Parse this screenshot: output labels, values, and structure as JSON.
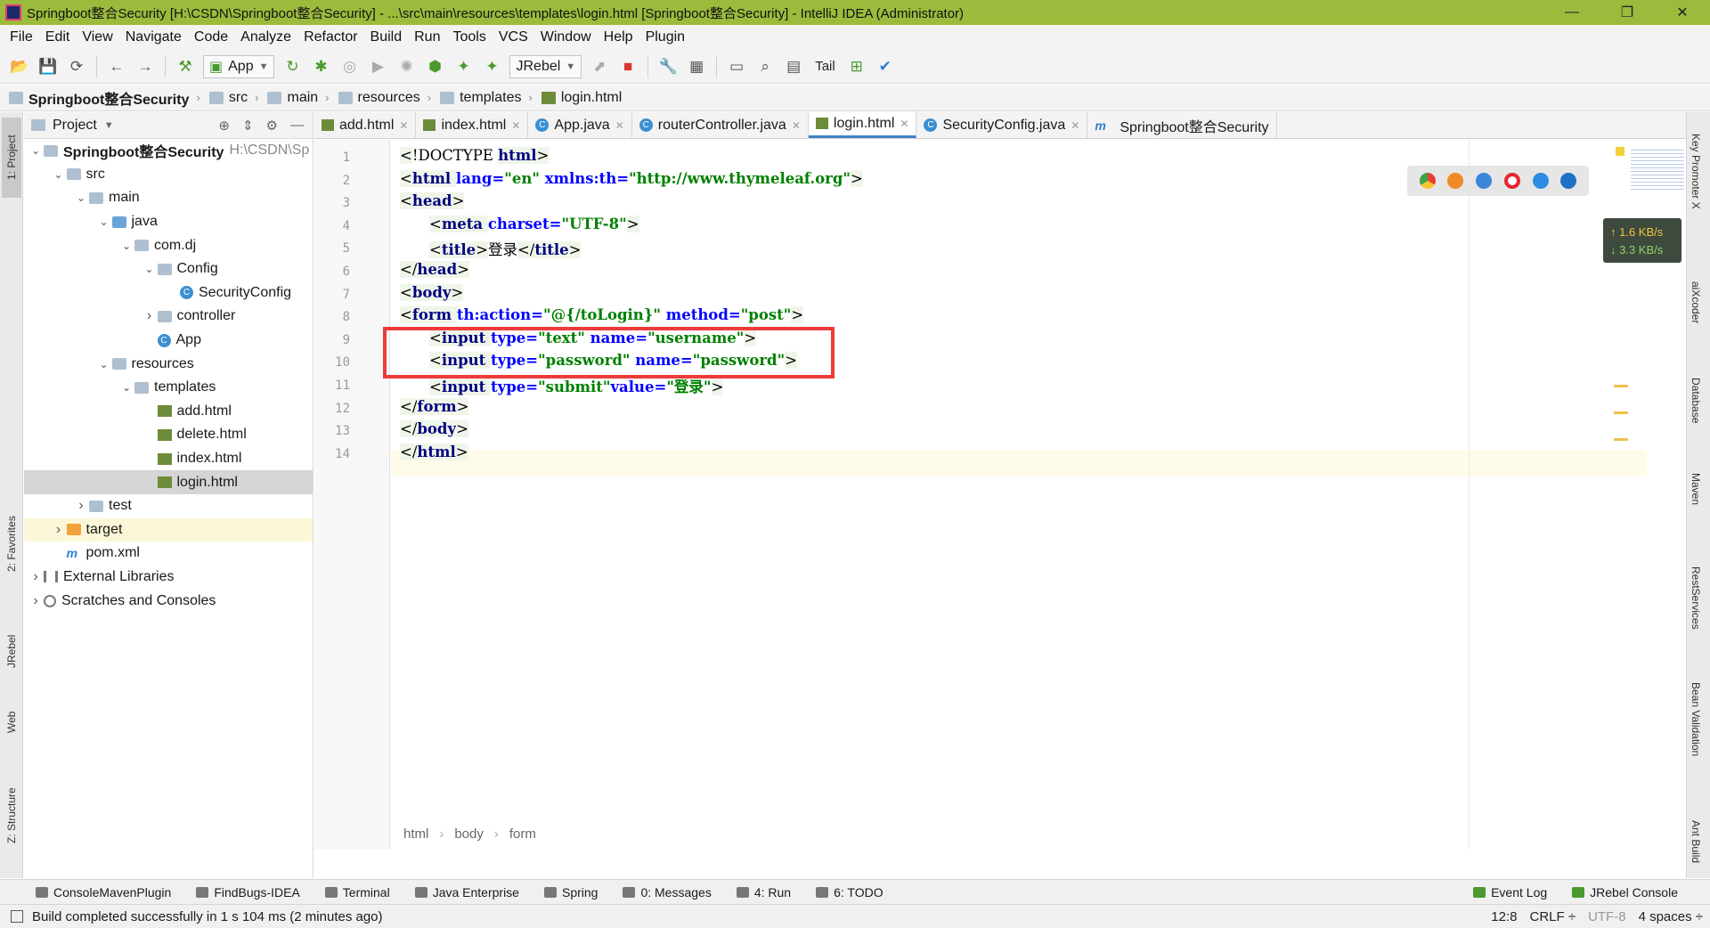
{
  "window": {
    "title": "Springboot整合Security [H:\\CSDN\\Springboot整合Security] - ...\\src\\main\\resources\\templates\\login.html [Springboot整合Security] - IntelliJ IDEA (Administrator)",
    "minimize": "—",
    "maximize": "❐",
    "close": "✕"
  },
  "menu": [
    "File",
    "Edit",
    "View",
    "Navigate",
    "Code",
    "Analyze",
    "Refactor",
    "Build",
    "Run",
    "Tools",
    "VCS",
    "Window",
    "Help",
    "Plugin"
  ],
  "toolbar": {
    "run_config": "App",
    "jrebel": "JRebel",
    "tail": "Tail"
  },
  "breadcrumb": [
    "Springboot整合Security",
    "src",
    "main",
    "resources",
    "templates",
    "login.html"
  ],
  "project": {
    "header": "Project",
    "tree": [
      {
        "label": "Springboot整合Security",
        "extra": "H:\\CSDN\\Sp",
        "depth": 0,
        "toggle": "open",
        "icon": "folder",
        "bold": true
      },
      {
        "label": "src",
        "depth": 1,
        "toggle": "open",
        "icon": "folder"
      },
      {
        "label": "main",
        "depth": 2,
        "toggle": "open",
        "icon": "folder"
      },
      {
        "label": "java",
        "depth": 3,
        "toggle": "open",
        "icon": "folder-blue"
      },
      {
        "label": "com.dj",
        "depth": 4,
        "toggle": "open",
        "icon": "folder"
      },
      {
        "label": "Config",
        "depth": 5,
        "toggle": "open",
        "icon": "folder"
      },
      {
        "label": "SecurityConfig",
        "depth": 6,
        "toggle": "",
        "icon": "class"
      },
      {
        "label": "controller",
        "depth": 5,
        "toggle": "closed",
        "icon": "folder"
      },
      {
        "label": "App",
        "depth": 5,
        "toggle": "",
        "icon": "class"
      },
      {
        "label": "resources",
        "depth": 3,
        "toggle": "open",
        "icon": "folder"
      },
      {
        "label": "templates",
        "depth": 4,
        "toggle": "open",
        "icon": "folder"
      },
      {
        "label": "add.html",
        "depth": 5,
        "toggle": "",
        "icon": "html"
      },
      {
        "label": "delete.html",
        "depth": 5,
        "toggle": "",
        "icon": "html"
      },
      {
        "label": "index.html",
        "depth": 5,
        "toggle": "",
        "icon": "html"
      },
      {
        "label": "login.html",
        "depth": 5,
        "toggle": "",
        "icon": "html",
        "selected": true
      },
      {
        "label": "test",
        "depth": 2,
        "toggle": "closed",
        "icon": "folder"
      },
      {
        "label": "target",
        "depth": 1,
        "toggle": "closed",
        "icon": "folder-orange",
        "highlight": true
      },
      {
        "label": "pom.xml",
        "depth": 1,
        "toggle": "",
        "icon": "maven"
      },
      {
        "label": "External Libraries",
        "depth": 0,
        "toggle": "closed",
        "icon": "lib"
      },
      {
        "label": "Scratches and Consoles",
        "depth": 0,
        "toggle": "closed",
        "icon": "scratch"
      }
    ]
  },
  "tabs": [
    {
      "label": "add.html",
      "icon": "html"
    },
    {
      "label": "index.html",
      "icon": "html"
    },
    {
      "label": "App.java",
      "icon": "class"
    },
    {
      "label": "routerController.java",
      "icon": "class"
    },
    {
      "label": "login.html",
      "icon": "html",
      "active": true
    },
    {
      "label": "SecurityConfig.java",
      "icon": "class"
    },
    {
      "label": "Springboot整合Security",
      "icon": "maven",
      "noclose": true
    }
  ],
  "editor": {
    "line_numbers": [
      "1",
      "2",
      "3",
      "4",
      "5",
      "6",
      "7",
      "8",
      "9",
      "10",
      "11",
      "12",
      "13",
      "14"
    ],
    "lines": [
      {
        "indent": 0,
        "parts": [
          [
            "br",
            "<"
          ],
          [
            "txt",
            "!DOCTYPE "
          ],
          [
            "tag",
            "html"
          ],
          [
            "br",
            ">"
          ]
        ]
      },
      {
        "indent": 0,
        "parts": [
          [
            "br",
            "<"
          ],
          [
            "tag",
            "html "
          ],
          [
            "attr",
            "lang="
          ],
          [
            "val",
            "\"en\" "
          ],
          [
            "attr",
            "xmlns:th="
          ],
          [
            "val",
            "\"http://www.thymeleaf.org\""
          ],
          [
            "br",
            ">"
          ]
        ]
      },
      {
        "indent": 0,
        "parts": [
          [
            "br",
            "<"
          ],
          [
            "tag",
            "head"
          ],
          [
            "br",
            ">"
          ]
        ]
      },
      {
        "indent": 1,
        "parts": [
          [
            "br",
            "<"
          ],
          [
            "tag",
            "meta "
          ],
          [
            "attr",
            "charset="
          ],
          [
            "val",
            "\"UTF-8\""
          ],
          [
            "br",
            ">"
          ]
        ]
      },
      {
        "indent": 1,
        "parts": [
          [
            "br",
            "<"
          ],
          [
            "tag",
            "title"
          ],
          [
            "br",
            ">"
          ],
          [
            "txt",
            "登录"
          ],
          [
            "br",
            "</"
          ],
          [
            "tag",
            "title"
          ],
          [
            "br",
            ">"
          ]
        ]
      },
      {
        "indent": 0,
        "parts": [
          [
            "br",
            "</"
          ],
          [
            "tag",
            "head"
          ],
          [
            "br",
            ">"
          ]
        ]
      },
      {
        "indent": 0,
        "parts": [
          [
            "br",
            "<"
          ],
          [
            "tag",
            "body"
          ],
          [
            "br",
            ">"
          ]
        ]
      },
      {
        "indent": 0,
        "parts": [
          [
            "br",
            "<"
          ],
          [
            "tag",
            "form "
          ],
          [
            "attr",
            "th:action="
          ],
          [
            "val",
            "\"@{/toLogin}\" "
          ],
          [
            "attr",
            "method="
          ],
          [
            "val",
            "\"post\""
          ],
          [
            "br",
            ">"
          ]
        ]
      },
      {
        "indent": 1,
        "parts": [
          [
            "br",
            "<"
          ],
          [
            "tag",
            "input "
          ],
          [
            "attr",
            "type="
          ],
          [
            "val",
            "\"text\" "
          ],
          [
            "attr",
            "name="
          ],
          [
            "val",
            "\"username\""
          ],
          [
            "br",
            ">"
          ]
        ]
      },
      {
        "indent": 1,
        "parts": [
          [
            "br",
            "<"
          ],
          [
            "tag",
            "input "
          ],
          [
            "attr",
            "type="
          ],
          [
            "val",
            "\"password\" "
          ],
          [
            "attr",
            "name="
          ],
          [
            "val",
            "\"password\""
          ],
          [
            "br",
            ">"
          ]
        ]
      },
      {
        "indent": 1,
        "parts": [
          [
            "br",
            "<"
          ],
          [
            "tag",
            "input "
          ],
          [
            "attr",
            "type="
          ],
          [
            "val",
            "\"submit\""
          ],
          [
            "attr",
            "value="
          ],
          [
            "val",
            "\"登录\""
          ],
          [
            "br",
            ">"
          ]
        ]
      },
      {
        "indent": 0,
        "parts": [
          [
            "br",
            "</"
          ],
          [
            "tag",
            "form"
          ],
          [
            "br",
            ">"
          ]
        ]
      },
      {
        "indent": 0,
        "parts": [
          [
            "br",
            "</"
          ],
          [
            "tag",
            "body"
          ],
          [
            "br",
            ">"
          ]
        ]
      },
      {
        "indent": 0,
        "parts": [
          [
            "br",
            "</"
          ],
          [
            "tag",
            "html"
          ],
          [
            "br",
            ">"
          ]
        ]
      }
    ],
    "crumbs": [
      "html",
      "form"
    ],
    "crumb_body": "body"
  },
  "net_speed": {
    "up": "↑ 1.6 KB/s",
    "down": "↓ 3.3 KB/s"
  },
  "left_strip": [
    "1: Project",
    "2: Favorites",
    "JRebel",
    "Web",
    "Z: Structure"
  ],
  "right_strip": [
    "Key Promoter X",
    "aiXcoder",
    "Database",
    "Maven",
    "RestServices",
    "Bean Validation",
    "Ant Build"
  ],
  "bottom_tabs": {
    "left": [
      "ConsoleMavenPlugin",
      "FindBugs-IDEA",
      "Terminal",
      "Java Enterprise",
      "Spring",
      "0: Messages",
      "4: Run",
      "6: TODO"
    ],
    "right": [
      "Event Log",
      "JRebel Console"
    ]
  },
  "status": {
    "message": "Build completed successfully in 1 s 104 ms (2 minutes ago)",
    "position": "12:8",
    "line_sep": "CRLF ÷",
    "encoding": "UTF-8",
    "indent": "4 spaces ÷"
  }
}
